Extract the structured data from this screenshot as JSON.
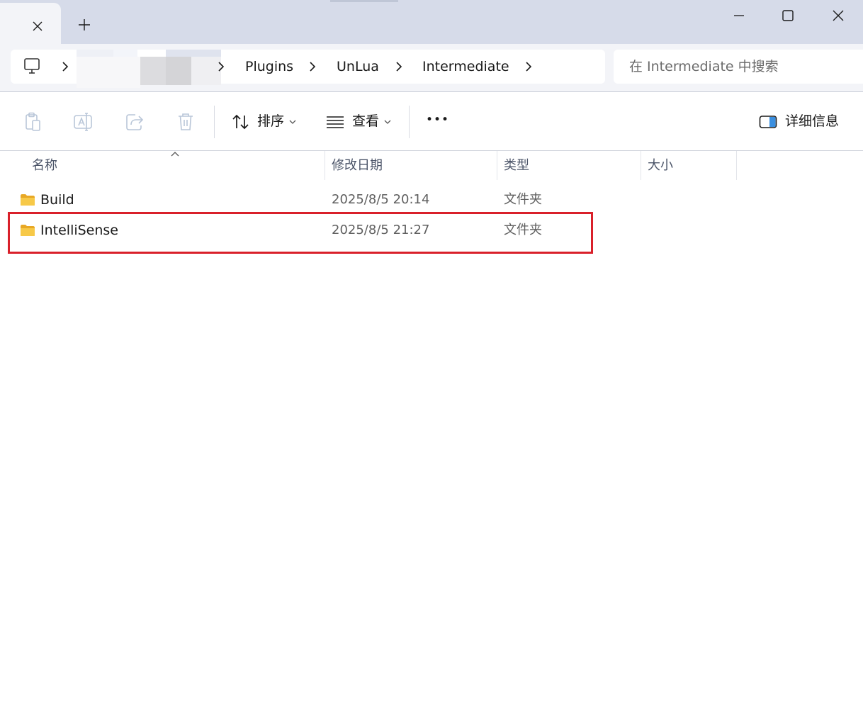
{
  "titlebar": {
    "tab_close_icon": "close-icon",
    "new_tab_icon": "plus-icon",
    "window_controls": [
      "minimize-icon",
      "maximize-icon",
      "close-icon"
    ]
  },
  "address": {
    "crumbs": [
      "Plugins",
      "UnLua",
      "Intermediate"
    ],
    "root_icon": "computer-icon",
    "separator_icon": "chevron-right-icon"
  },
  "search": {
    "placeholder": "在 Intermediate 中搜索"
  },
  "toolbar": {
    "sort_label": "排序",
    "view_label": "查看",
    "more_label": "•••",
    "details_label": "详细信息"
  },
  "columns": {
    "name": "名称",
    "modified": "修改日期",
    "type": "类型",
    "size": "大小"
  },
  "files": [
    {
      "name": "Build",
      "modified": "2025/8/5 20:14",
      "type": "文件夹",
      "size": ""
    },
    {
      "name": "IntelliSense",
      "modified": "2025/8/5 21:27",
      "type": "文件夹",
      "size": ""
    }
  ],
  "colors": {
    "titlebar": "#d6dbe9",
    "highlight_border": "#d9202a",
    "folder": "#f7c948"
  }
}
